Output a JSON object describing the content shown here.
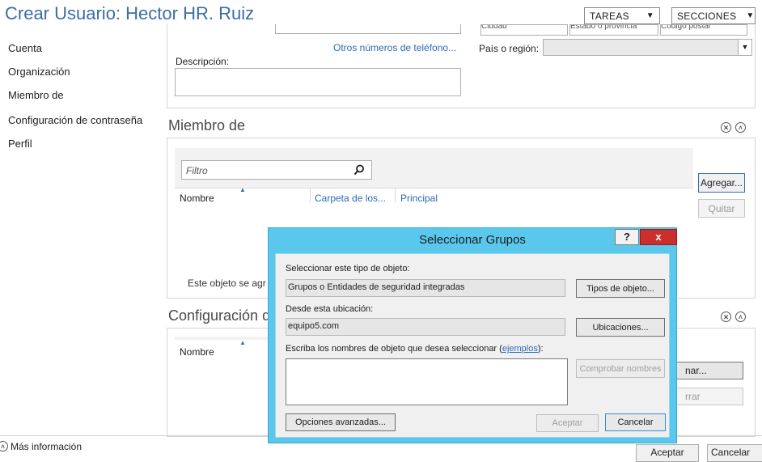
{
  "window": {
    "title": "Crear Usuario: Hector HR. Ruiz"
  },
  "toolbar": {
    "tasks": "TAREAS",
    "sections": "SECCIONES"
  },
  "nav": [
    {
      "label": "Cuenta"
    },
    {
      "label": "Organización"
    },
    {
      "label": "Miembro de"
    },
    {
      "label": "Configuración de contraseña"
    },
    {
      "label": "Perfil"
    }
  ],
  "top_form": {
    "other_phones_link": "Otros números de teléfono...",
    "description_label": "Descripción:",
    "country_label": "País o región:",
    "partial_headers": [
      "Ciudad",
      "Estado o provincia",
      "Código postal"
    ]
  },
  "member_of": {
    "title": "Miembro de",
    "filter_placeholder": "Filtro",
    "columns": [
      "Nombre",
      "Carpeta de los...",
      "Principal"
    ],
    "add_button": "Agregar...",
    "remove_button": "Quitar",
    "status_text": "Este objeto se agr"
  },
  "password_settings": {
    "title": "Configuración d",
    "columns": [
      "Nombre"
    ],
    "add_button_partial": "nar...",
    "remove_button_partial": "rrar"
  },
  "footer": {
    "more_info": "Más información",
    "ok": "Aceptar",
    "cancel": "Cancelar"
  },
  "dialog": {
    "title": "Seleccionar Grupos",
    "help_button": "?",
    "close_button": "x",
    "object_type_label": "Seleccionar este tipo de objeto:",
    "object_type_value": "Grupos o Entidades de seguridad integradas",
    "object_types_button": "Tipos de objeto...",
    "location_label": "Desde esta ubicación:",
    "location_value": "equipo5.com",
    "locations_button": "Ubicaciones...",
    "names_label_prefix": "Escriba los nombres de objeto que desea seleccionar (",
    "names_label_link": "ejemplos",
    "names_label_suffix": "):",
    "names_value": "",
    "check_names_button": "Comprobar nombres",
    "advanced_button": "Opciones avanzadas...",
    "ok_button": "Aceptar",
    "cancel_button": "Cancelar"
  },
  "colors": {
    "title": "#3a6ea8",
    "dialog_frame": "#5ac8ec",
    "close_red": "#c9302c",
    "link": "#2d6bb5"
  }
}
